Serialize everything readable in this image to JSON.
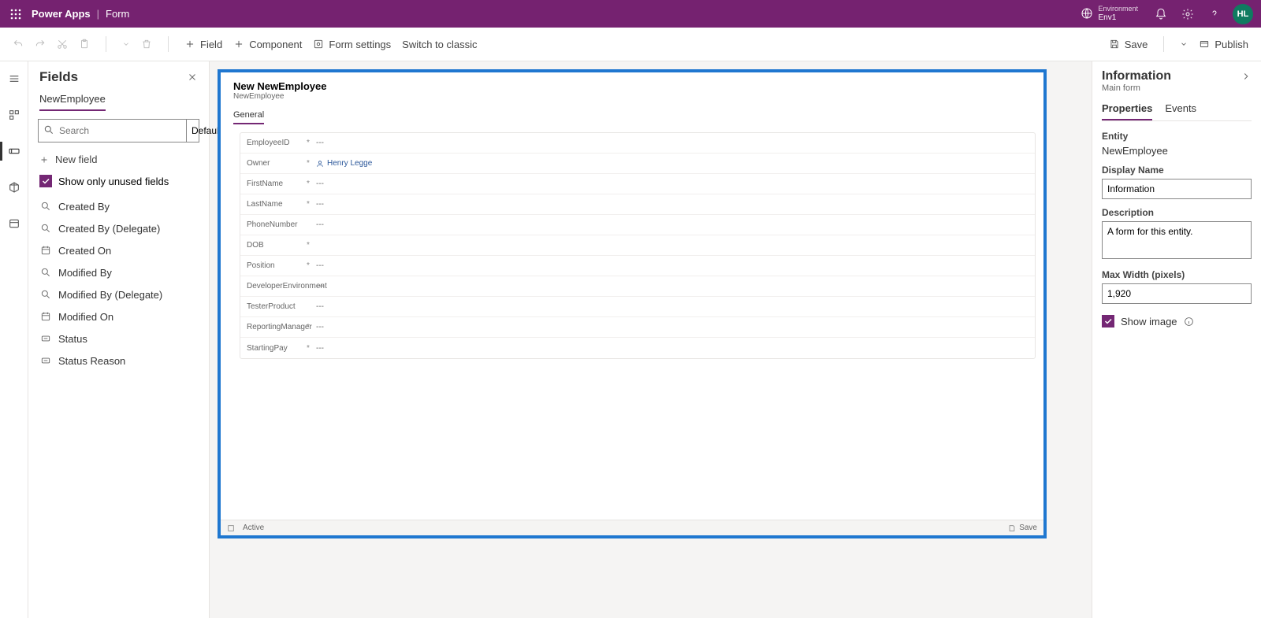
{
  "topbar": {
    "brand": "Power Apps",
    "page": "Form",
    "env_label": "Environment",
    "env_name": "Env1",
    "avatar": "HL"
  },
  "cmdbar": {
    "field": "Field",
    "component": "Component",
    "form_settings": "Form settings",
    "switch_classic": "Switch to classic",
    "save": "Save",
    "publish": "Publish"
  },
  "fields_panel": {
    "title": "Fields",
    "tab": "NewEmployee",
    "search_placeholder": "Search",
    "filter_default": "Default",
    "new_field": "New field",
    "show_unused": "Show only unused fields",
    "items": [
      {
        "icon": "lookup",
        "label": "Created By"
      },
      {
        "icon": "lookup",
        "label": "Created By (Delegate)"
      },
      {
        "icon": "date",
        "label": "Created On"
      },
      {
        "icon": "lookup",
        "label": "Modified By"
      },
      {
        "icon": "lookup",
        "label": "Modified By (Delegate)"
      },
      {
        "icon": "date",
        "label": "Modified On"
      },
      {
        "icon": "choice",
        "label": "Status"
      },
      {
        "icon": "choice",
        "label": "Status Reason"
      }
    ]
  },
  "canvas": {
    "title": "New NewEmployee",
    "subtitle": "NewEmployee",
    "tab": "General",
    "rows": [
      {
        "label": "EmployeeID",
        "required": "*",
        "value": "---"
      },
      {
        "label": "Owner",
        "required": "*",
        "value": "Henry Legge",
        "owner": true
      },
      {
        "label": "FirstName",
        "required": "*",
        "value": "---"
      },
      {
        "label": "LastName",
        "required": "*",
        "value": "---"
      },
      {
        "label": "PhoneNumber",
        "required": "",
        "value": "---"
      },
      {
        "label": "DOB",
        "required": "*",
        "value": ""
      },
      {
        "label": "Position",
        "required": "*",
        "value": "---"
      },
      {
        "label": "DeveloperEnvironment",
        "required": "",
        "value": "---"
      },
      {
        "label": "TesterProduct",
        "required": "",
        "value": "---"
      },
      {
        "label": "ReportingManager",
        "required": "*",
        "value": "---"
      },
      {
        "label": "StartingPay",
        "required": "*",
        "value": "---"
      }
    ],
    "footer_status": "Active",
    "footer_save": "Save"
  },
  "props": {
    "title": "Information",
    "subtitle": "Main form",
    "tab_properties": "Properties",
    "tab_events": "Events",
    "entity_label": "Entity",
    "entity_value": "NewEmployee",
    "display_name_label": "Display Name",
    "display_name_value": "Information",
    "description_label": "Description",
    "description_value": "A form for this entity.",
    "maxwidth_label": "Max Width (pixels)",
    "maxwidth_value": "1,920",
    "show_image": "Show image"
  }
}
